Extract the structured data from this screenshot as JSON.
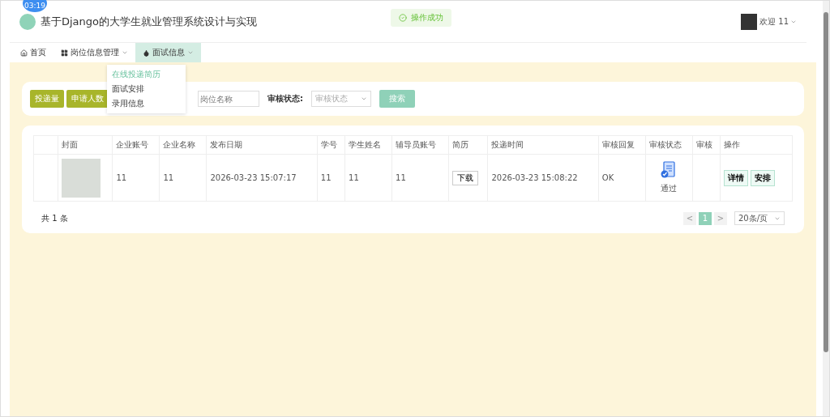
{
  "timer_badge": "03:19",
  "header": {
    "title": "基于Django的大学生就业管理系统设计与实现",
    "user": "欢迎 11"
  },
  "toast": {
    "text": "操作成功"
  },
  "nav": [
    {
      "label": "首页",
      "selected": false
    },
    {
      "label": "岗位信息管理",
      "selected": false
    },
    {
      "label": "面试信息",
      "selected": true
    }
  ],
  "dropdown": [
    {
      "label": "在线投递简历",
      "selected": true
    },
    {
      "label": "面试安排",
      "selected": false
    },
    {
      "label": "录用信息",
      "selected": false
    }
  ],
  "search": {
    "buttons": [
      "投递量",
      "申请人数"
    ],
    "name_placeholder": "岗位名称",
    "status_label": "审核状态:",
    "status_placeholder": "审核状态",
    "search_button": "搜索"
  },
  "table": {
    "columns": [
      "封面",
      "企业账号",
      "企业名称",
      "发布日期",
      "学号",
      "学生姓名",
      "辅导员账号",
      "简历",
      "投递时间",
      "审核回复",
      "审核状态",
      "审核",
      "操作"
    ],
    "rows": [
      {
        "cells": [
          {
            "kind": "image"
          },
          {
            "kind": "text",
            "text": "11"
          },
          {
            "kind": "text",
            "text": "11"
          },
          {
            "kind": "text",
            "text": "2026-03-23 15:07:17"
          },
          {
            "kind": "text",
            "text": "11"
          },
          {
            "kind": "text",
            "text": "11"
          },
          {
            "kind": "text",
            "text": "11"
          },
          {
            "kind": "download",
            "text": "下载"
          },
          {
            "kind": "text",
            "text": "2026-03-23 15:08:22"
          },
          {
            "kind": "text",
            "text": "OK"
          },
          {
            "kind": "status",
            "text": "通过"
          },
          {
            "kind": "empty"
          },
          {
            "kind": "actions",
            "buttons": [
              "详情",
              "安排"
            ]
          }
        ]
      }
    ]
  },
  "pagination": {
    "total": "共 1 条",
    "prev": "<",
    "pages": [
      {
        "label": "1",
        "selected": true
      }
    ],
    "next": ">",
    "page_size": "20条/页"
  }
}
